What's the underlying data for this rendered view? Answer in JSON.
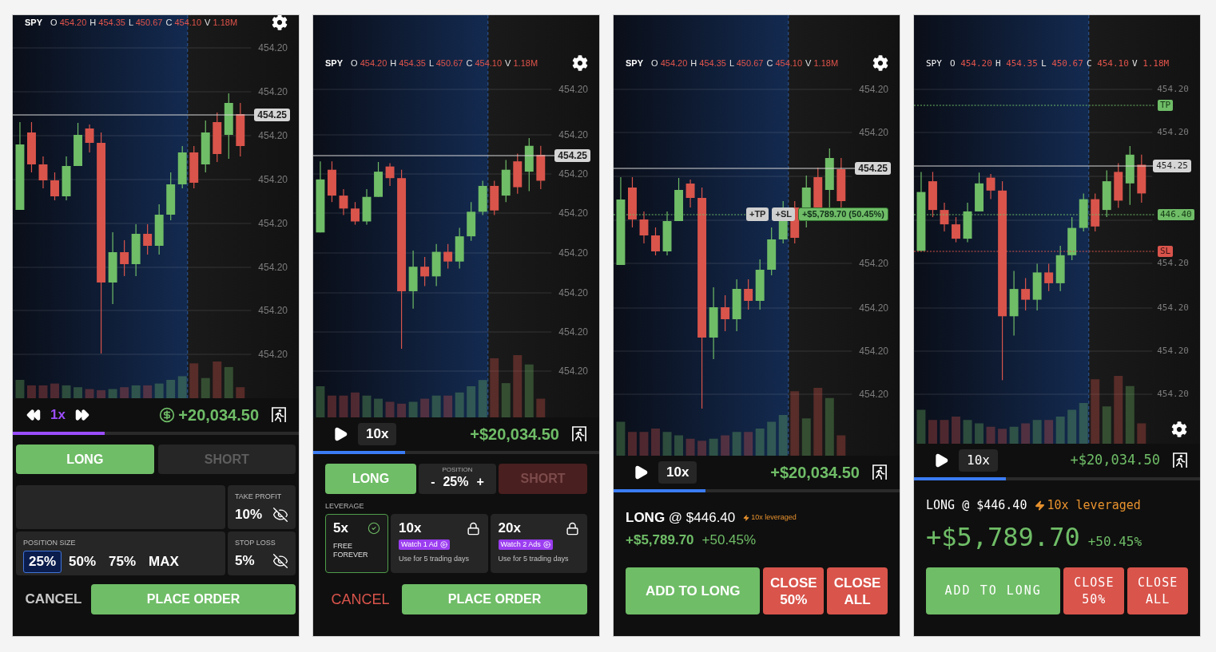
{
  "screens": [
    {
      "kind": "order",
      "header": {
        "ticker": "SPY",
        "quotes": [
          {
            "label": "O",
            "value": "454.20"
          },
          {
            "label": "H",
            "value": "454.35"
          },
          {
            "label": "L",
            "value": "450.67"
          },
          {
            "label": "C",
            "value": "454.10"
          },
          {
            "label": "V",
            "value": "1.18M"
          }
        ]
      },
      "chart": {
        "axis_labels": [
          "454.20",
          "454.20",
          "454.20",
          "454.20",
          "454.20",
          "454.20",
          "454.20",
          "454.20"
        ],
        "price_tag": "454.25"
      },
      "playback": {
        "kind": "skip",
        "speed": "1x",
        "balance": "+20,034.50"
      },
      "progress": {
        "level": 0.32
      },
      "order": {
        "sides": [
          {
            "label": "LONG",
            "selected": true
          },
          {
            "label": "SHORT",
            "selected": false
          }
        ],
        "take_profit": {
          "label": "TAKE PROFIT",
          "value": "10%"
        },
        "position_size": {
          "label": "POSITION SIZE",
          "options": [
            {
              "label": "25%",
              "selected": true
            },
            {
              "label": "50%",
              "selected": false
            },
            {
              "label": "75%",
              "selected": false
            },
            {
              "label": "MAX",
              "selected": false
            }
          ]
        },
        "stop_loss": {
          "label": "STOP LOSS",
          "value": "5%"
        },
        "actions": [
          {
            "label": "CANCEL",
            "kind": "muted"
          },
          {
            "label": "PLACE ORDER",
            "kind": "primary"
          }
        ]
      }
    },
    {
      "kind": "leverage_order",
      "header": {
        "ticker": "SPY",
        "quotes": [
          {
            "label": "O",
            "value": "454.20"
          },
          {
            "label": "H",
            "value": "454.35"
          },
          {
            "label": "L",
            "value": "450.67"
          },
          {
            "label": "C",
            "value": "454.10"
          },
          {
            "label": "V",
            "value": "1.18M"
          }
        ]
      },
      "chart": {
        "axis_labels": [
          "454.20",
          "454.20",
          "454.20",
          "454.20",
          "454.20",
          "454.20",
          "454.20",
          "454.20"
        ],
        "price_tag": "454.25"
      },
      "playback": {
        "kind": "play",
        "speed": "10x",
        "balance": "+$20,034.50"
      },
      "progress": {
        "level": 0.32
      },
      "order": {
        "sides": [
          {
            "label": "LONG",
            "selected": true
          },
          {
            "label": "SHORT",
            "selected": false
          }
        ],
        "position": {
          "label": "POSITION",
          "decrement": "-",
          "value": "25%",
          "increment": "+"
        },
        "leverage": {
          "label": "LEVERAGE",
          "options": [
            {
              "value": "5x",
              "note": "FREE FOREVER",
              "locked": false,
              "selected": true
            },
            {
              "value": "10x",
              "badge": "Watch 1 Ad",
              "note": "Use for 5 trading days",
              "locked": true,
              "selected": false
            },
            {
              "value": "20x",
              "badge": "Watch 2 Ads",
              "note": "Use for 5 trading days",
              "locked": true,
              "selected": false
            }
          ]
        },
        "actions": [
          {
            "label": "CANCEL",
            "kind": "danger"
          },
          {
            "label": "PLACE ORDER",
            "kind": "primary"
          }
        ]
      }
    },
    {
      "kind": "position",
      "header": {
        "ticker": "SPY",
        "quotes": [
          {
            "label": "O",
            "value": "454.20"
          },
          {
            "label": "H",
            "value": "454.35"
          },
          {
            "label": "L",
            "value": "450.67"
          },
          {
            "label": "C",
            "value": "454.10"
          },
          {
            "label": "V",
            "value": "1.18M"
          }
        ]
      },
      "chart": {
        "axis_labels": [
          "454.20",
          "454.20",
          "454.20",
          "454.20",
          "454.20",
          "454.20"
        ],
        "price_tag": "454.25",
        "markers": [
          {
            "label": "+TP",
            "kind": "add_tp"
          },
          {
            "label": "+SL",
            "kind": "add_sl"
          },
          {
            "label": "+$5,789.70 (50.45%)",
            "kind": "pnl"
          }
        ]
      },
      "playback": {
        "kind": "play",
        "speed": "10x",
        "balance": "+$20,034.50"
      },
      "progress": {
        "level": 0.32
      },
      "position": {
        "entry": "**LONG** @ $446.40",
        "leverage": "10x leveraged",
        "pnl": "+$5,789.70",
        "pnl_percent": "+50.45%",
        "actions": [
          {
            "label": "ADD TO LONG",
            "kind": "add"
          },
          {
            "label": "CLOSE 50%",
            "kind": "close"
          },
          {
            "label": "CLOSE ALL",
            "kind": "close"
          }
        ]
      }
    },
    {
      "kind": "position",
      "header": {
        "ticker": "SPY",
        "quotes": [
          {
            "label": "O",
            "value": "454.20"
          },
          {
            "label": "H",
            "value": "454.35"
          },
          {
            "label": "L",
            "value": "450.67"
          },
          {
            "label": "C",
            "value": "454.10"
          },
          {
            "label": "V",
            "value": "1.18M"
          }
        ]
      },
      "chart": {
        "axis_labels": [
          "454.20",
          "454.20",
          "454.20",
          "454.20",
          "454.20",
          "454.20"
        ],
        "price_tag": "454.25",
        "markers": [
          {
            "label": "TP",
            "kind": "tp"
          },
          {
            "label": "446.40",
            "kind": "entry"
          },
          {
            "label": "SL",
            "kind": "sl"
          }
        ]
      },
      "playback": {
        "kind": "play",
        "speed": "10x",
        "balance": "+$20,034.50"
      },
      "progress": {
        "level": 0.32
      },
      "position": {
        "entry": "LONG @ $446.40",
        "leverage": "10x leveraged",
        "pnl": "+$5,789.70",
        "pnl_percent": "+50.45%",
        "actions": [
          {
            "label": "ADD TO LONG",
            "kind": "add"
          },
          {
            "label": "CLOSE 50%",
            "kind": "close"
          },
          {
            "label": "CLOSE ALL",
            "kind": "close"
          }
        ]
      }
    }
  ]
}
